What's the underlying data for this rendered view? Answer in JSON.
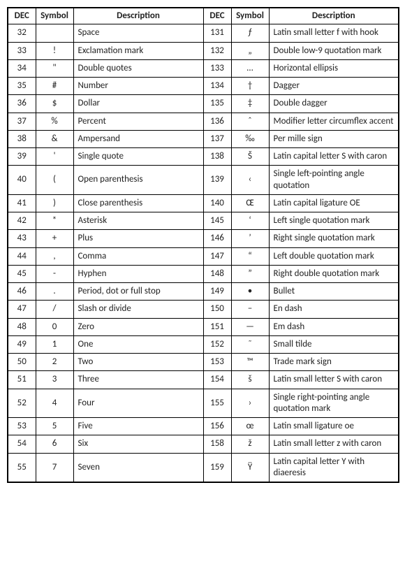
{
  "headers": {
    "dec": "DEC",
    "symbol": "Symbol",
    "description": "Description"
  },
  "rows": [
    {
      "l": {
        "dec": "32",
        "sym": "",
        "desc": "Space"
      },
      "r": {
        "dec": "131",
        "sym": "ƒ",
        "desc": "Latin small letter f with hook"
      }
    },
    {
      "l": {
        "dec": "33",
        "sym": "!",
        "desc": "Exclamation mark"
      },
      "r": {
        "dec": "132",
        "sym": "„",
        "desc": "Double low-9 quotation mark"
      }
    },
    {
      "l": {
        "dec": "34",
        "sym": "\"",
        "desc": "Double quotes"
      },
      "r": {
        "dec": "133",
        "sym": "…",
        "desc": "Horizontal ellipsis"
      }
    },
    {
      "l": {
        "dec": "35",
        "sym": "#",
        "desc": "Number"
      },
      "r": {
        "dec": "134",
        "sym": "†",
        "desc": "Dagger"
      }
    },
    {
      "l": {
        "dec": "36",
        "sym": "$",
        "desc": "Dollar"
      },
      "r": {
        "dec": "135",
        "sym": "‡",
        "desc": "Double dagger"
      }
    },
    {
      "l": {
        "dec": "37",
        "sym": "%",
        "desc": "Percent"
      },
      "r": {
        "dec": "136",
        "sym": "ˆ",
        "desc": "Modifier letter circumflex accent"
      }
    },
    {
      "l": {
        "dec": "38",
        "sym": "&",
        "desc": "Ampersand"
      },
      "r": {
        "dec": "137",
        "sym": "‰",
        "desc": "Per mille sign"
      }
    },
    {
      "l": {
        "dec": "39",
        "sym": "'",
        "desc": "Single quote"
      },
      "r": {
        "dec": "138",
        "sym": "Š",
        "desc": "Latin capital letter S with caron"
      }
    },
    {
      "l": {
        "dec": "40",
        "sym": "(",
        "desc": "Open parenthesis"
      },
      "r": {
        "dec": "139",
        "sym": "‹",
        "desc": "Single left-pointing angle quotation"
      }
    },
    {
      "l": {
        "dec": "41",
        "sym": ")",
        "desc": "Close parenthesis"
      },
      "r": {
        "dec": "140",
        "sym": "Œ",
        "desc": "Latin capital ligature OE"
      }
    },
    {
      "l": {
        "dec": "42",
        "sym": "*",
        "desc": "Asterisk"
      },
      "r": {
        "dec": "145",
        "sym": "‘",
        "desc": "Left single quotation mark"
      }
    },
    {
      "l": {
        "dec": "43",
        "sym": "+",
        "desc": "Plus"
      },
      "r": {
        "dec": "146",
        "sym": "’",
        "desc": "Right single quotation mark"
      }
    },
    {
      "l": {
        "dec": "44",
        "sym": ",",
        "desc": "Comma"
      },
      "r": {
        "dec": "147",
        "sym": "“",
        "desc": "Left double quotation mark"
      }
    },
    {
      "l": {
        "dec": "45",
        "sym": "-",
        "desc": "Hyphen"
      },
      "r": {
        "dec": "148",
        "sym": "”",
        "desc": "Right double quotation mark"
      }
    },
    {
      "l": {
        "dec": "46",
        "sym": ".",
        "desc": "Period, dot or full stop"
      },
      "r": {
        "dec": "149",
        "sym": "•",
        "desc": "Bullet"
      }
    },
    {
      "l": {
        "dec": "47",
        "sym": "/",
        "desc": "Slash or divide"
      },
      "r": {
        "dec": "150",
        "sym": "–",
        "desc": "En dash"
      }
    },
    {
      "l": {
        "dec": "48",
        "sym": "0",
        "desc": "Zero"
      },
      "r": {
        "dec": "151",
        "sym": "—",
        "desc": "Em dash"
      }
    },
    {
      "l": {
        "dec": "49",
        "sym": "1",
        "desc": "One"
      },
      "r": {
        "dec": "152",
        "sym": "˜",
        "desc": "Small tilde"
      }
    },
    {
      "l": {
        "dec": "50",
        "sym": "2",
        "desc": "Two"
      },
      "r": {
        "dec": "153",
        "sym": "™",
        "desc": "Trade mark sign"
      }
    },
    {
      "l": {
        "dec": "51",
        "sym": "3",
        "desc": "Three"
      },
      "r": {
        "dec": "154",
        "sym": "š",
        "desc": "Latin small letter S with caron"
      }
    },
    {
      "l": {
        "dec": "52",
        "sym": "4",
        "desc": "Four"
      },
      "r": {
        "dec": "155",
        "sym": "›",
        "desc": "Single right-pointing angle quotation mark"
      }
    },
    {
      "l": {
        "dec": "53",
        "sym": "5",
        "desc": "Five"
      },
      "r": {
        "dec": "156",
        "sym": "œ",
        "desc": "Latin small ligature oe"
      }
    },
    {
      "l": {
        "dec": "54",
        "sym": "6",
        "desc": "Six"
      },
      "r": {
        "dec": "158",
        "sym": "ž",
        "desc": "Latin small letter z with caron"
      }
    },
    {
      "l": {
        "dec": "55",
        "sym": "7",
        "desc": "Seven"
      },
      "r": {
        "dec": "159",
        "sym": "Ÿ",
        "desc": "Latin capital letter Y with diaeresis"
      }
    }
  ]
}
